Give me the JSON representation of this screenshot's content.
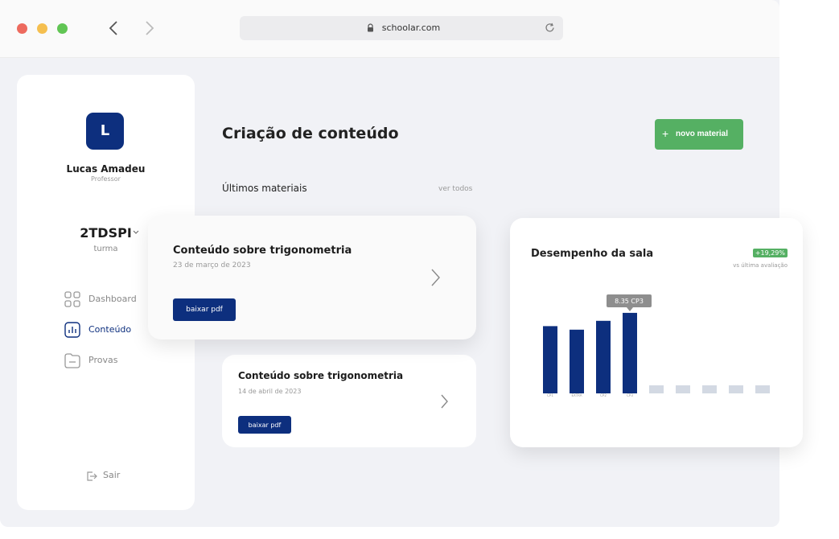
{
  "browser": {
    "url": "schoolar.com",
    "colors": {
      "close": "#ed6a5e",
      "minimize": "#f5bf4f",
      "maximize": "#61c554"
    }
  },
  "sidebar": {
    "avatar_initial": "L",
    "user_name": "Lucas Amadeu",
    "user_role": "Professor",
    "class_name": "2TDSPI",
    "class_label": "turma",
    "menu": [
      {
        "label": "Dashboard",
        "icon": "grid-icon",
        "active": false
      },
      {
        "label": "Conteúdo",
        "icon": "chart-icon",
        "active": true
      },
      {
        "label": "Provas",
        "icon": "folder-icon",
        "active": false
      }
    ],
    "logout_label": "Sair"
  },
  "main": {
    "title": "Criação de conteúdo",
    "new_button": "novo material",
    "section_title": "Últimos materiais",
    "see_all": "ver todos",
    "materials": [
      {
        "title": "Conteúdo sobre trigonometria",
        "date": "23 de março de 2023",
        "button": "baixar pdf"
      },
      {
        "title": "Conteúdo sobre trigonometria",
        "date": "14 de abril de 2023",
        "button": "baixar pdf"
      }
    ]
  },
  "performance": {
    "title": "Desempenho da sala",
    "badge": "+19,29%",
    "subtitle": "vs última avaliação"
  },
  "chart_data": {
    "type": "bar",
    "categories": [
      "CP1",
      "EXTRA",
      "CP2",
      "CP3",
      "",
      "",
      "",
      "",
      ""
    ],
    "values": [
      7.6,
      7.2,
      8.2,
      9.1,
      0.9,
      0.9,
      0.9,
      0.9,
      0.9
    ],
    "active": [
      true,
      true,
      true,
      true,
      false,
      false,
      false,
      false,
      false
    ],
    "tooltip": {
      "value": "8.35",
      "label": "CP3",
      "index": 3
    },
    "colors": {
      "active": "#0d2f7e",
      "inactive": "#d3d9e3"
    }
  }
}
